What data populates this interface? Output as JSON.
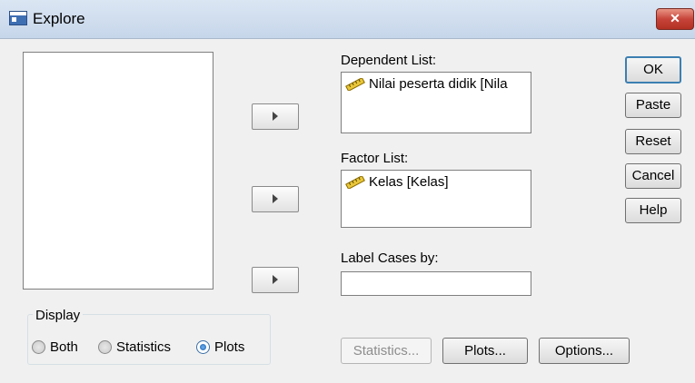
{
  "window": {
    "title": "Explore",
    "close_label": "✕"
  },
  "dependent_list": {
    "label": "Dependent List:",
    "items": [
      "Nilai peserta didik [Nila"
    ]
  },
  "factor_list": {
    "label": "Factor List:",
    "items": [
      "Kelas [Kelas]"
    ]
  },
  "label_cases": {
    "label": "Label Cases by:",
    "value": ""
  },
  "side_buttons": {
    "ok": "OK",
    "paste": "Paste",
    "reset": "Reset",
    "cancel": "Cancel",
    "help": "Help"
  },
  "display": {
    "legend": "Display",
    "options": [
      {
        "label": "Both",
        "selected": false
      },
      {
        "label": "Statistics",
        "selected": false
      },
      {
        "label": "Plots",
        "selected": true
      }
    ]
  },
  "bottom_buttons": {
    "statistics": "Statistics...",
    "plots": "Plots...",
    "options": "Options..."
  },
  "icons": {
    "variable": "scale-ruler-icon",
    "move": "right-arrow-icon"
  }
}
